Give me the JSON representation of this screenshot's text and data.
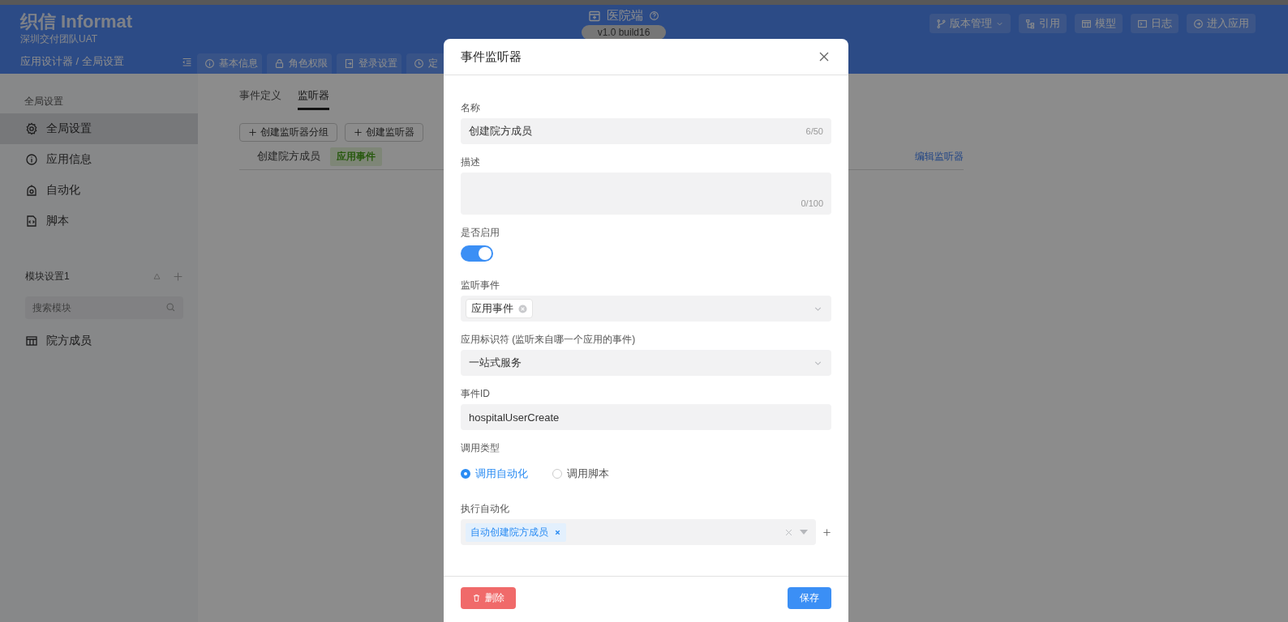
{
  "header": {
    "logo": "织信 Informat",
    "team": "深圳交付团队UAT",
    "breadcrumb": "应用设计器 / 全局设置",
    "app_name": "医院端",
    "version": "v1.0 build16",
    "actions": [
      {
        "label": "版本管理",
        "kind": "dropdown"
      },
      {
        "label": "引用",
        "kind": "button"
      },
      {
        "label": "模型",
        "kind": "button"
      },
      {
        "label": "日志",
        "kind": "button"
      },
      {
        "label": "进入应用",
        "kind": "button"
      }
    ],
    "tabs": [
      {
        "label": "基本信息"
      },
      {
        "label": "角色权限"
      },
      {
        "label": "登录设置"
      },
      {
        "label": "定"
      }
    ]
  },
  "sidebar": {
    "section_title": "全局设置",
    "items": [
      {
        "label": "全局设置",
        "selected": true
      },
      {
        "label": "应用信息",
        "selected": false
      },
      {
        "label": "自动化",
        "selected": false
      },
      {
        "label": "脚本",
        "selected": false
      }
    ],
    "module_group": {
      "title": "模块设置1",
      "search_placeholder": "搜索模块",
      "items": [
        {
          "label": "院方成员"
        }
      ]
    }
  },
  "content": {
    "tabs": [
      {
        "label": "事件定义",
        "selected": false
      },
      {
        "label": "监听器",
        "selected": true
      }
    ],
    "buttons": [
      "创建监听器分组",
      "创建监听器"
    ],
    "listeners": [
      {
        "name": "创建院方成员",
        "tag": "应用事件",
        "action": "编辑监听器"
      }
    ]
  },
  "modal": {
    "title": "事件监听器",
    "fields": [
      {
        "kind": "input",
        "label": "名称",
        "value": "创建院方成员",
        "counter": "6/50"
      },
      {
        "kind": "textarea",
        "label": "描述",
        "counter": "0/100"
      },
      {
        "kind": "switch",
        "label": "是否启用",
        "on": true
      },
      {
        "kind": "tag-select",
        "label": "监听事件",
        "tags": [
          "应用事件"
        ]
      },
      {
        "kind": "select",
        "label": "应用标识符 (监听来自哪一个应用的事件)",
        "value": "一站式服务"
      },
      {
        "kind": "input",
        "label": "事件ID",
        "value": "hospitalUserCreate"
      },
      {
        "kind": "radio",
        "label": "调用类型",
        "options": [
          {
            "label": "调用自动化",
            "selected": true
          },
          {
            "label": "调用脚本",
            "selected": false
          }
        ]
      },
      {
        "kind": "multi-select",
        "label": "执行自动化",
        "tags": [
          "自动创建院方成员"
        ]
      }
    ],
    "delete_button": "删除",
    "save_button": "保存"
  }
}
